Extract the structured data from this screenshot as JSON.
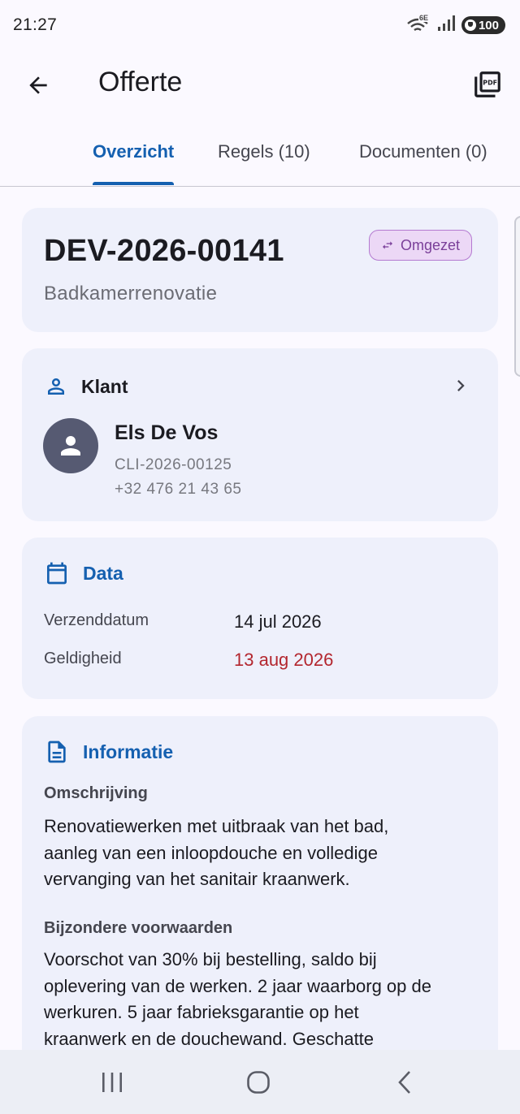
{
  "status_bar": {
    "time": "21:27",
    "network": "6E",
    "battery": "100"
  },
  "app_bar": {
    "title": "Offerte"
  },
  "tabs": [
    {
      "label": "Overzicht"
    },
    {
      "label": "Regels (10)"
    },
    {
      "label": "Documenten (0)"
    }
  ],
  "quote": {
    "number": "DEV-2026-00141",
    "subtitle": "Badkamerrenovatie",
    "status": "Omgezet"
  },
  "client": {
    "heading": "Klant",
    "name": "Els De Vos",
    "id": "CLI-2026-00125",
    "phone": "+32 476 21 43 65"
  },
  "dates": {
    "heading": "Data",
    "rows": [
      {
        "label": "Verzenddatum",
        "value": "14 jul 2026"
      },
      {
        "label": "Geldigheid",
        "value": "13 aug 2026"
      }
    ]
  },
  "info": {
    "heading": "Informatie",
    "description_label": "Omschrijving",
    "description_lines": [
      "Renovatiewerken met uitbraak van het bad,",
      "aanleg van een inloopdouche en volledige",
      "vervanging van het sanitair kraanwerk."
    ],
    "conditions_label": "Bijzondere voorwaarden",
    "conditions_lines": [
      "Voorschot van 30% bij bestelling, saldo bij",
      "oplevering van de werken. 2 jaar waarborg op de",
      "werkuren. 5 jaar fabrieksgarantie op het",
      "kraanwerk en de douchewand. Geschatte"
    ]
  },
  "colors": {
    "accent": "#1560b0",
    "danger": "#b3262e",
    "card": "#eef0fb",
    "badge": "#ecd8f6"
  }
}
